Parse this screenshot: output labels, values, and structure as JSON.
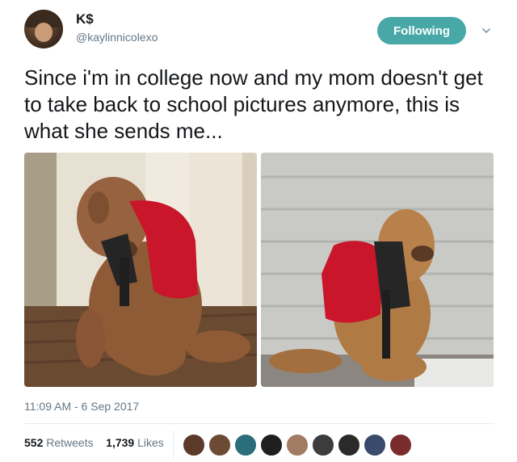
{
  "tweet": {
    "name": "K$",
    "handle": "@kaylinnicolexo",
    "follow_label": "Following",
    "text": "Since i'm in college now and my mom doesn't get to take back to school pictures anymore, this is what she sends me...",
    "timestamp": "11:09 AM - 6 Sep 2017",
    "retweets_count": "552",
    "retweets_label": "Retweets",
    "likes_count": "1,739",
    "likes_label": "Likes"
  },
  "colors": {
    "follow_button": "#48a8a8",
    "secondary_text": "#657786",
    "primary_text": "#14171a"
  },
  "icons": {
    "caret": "chevron-down-icon"
  }
}
